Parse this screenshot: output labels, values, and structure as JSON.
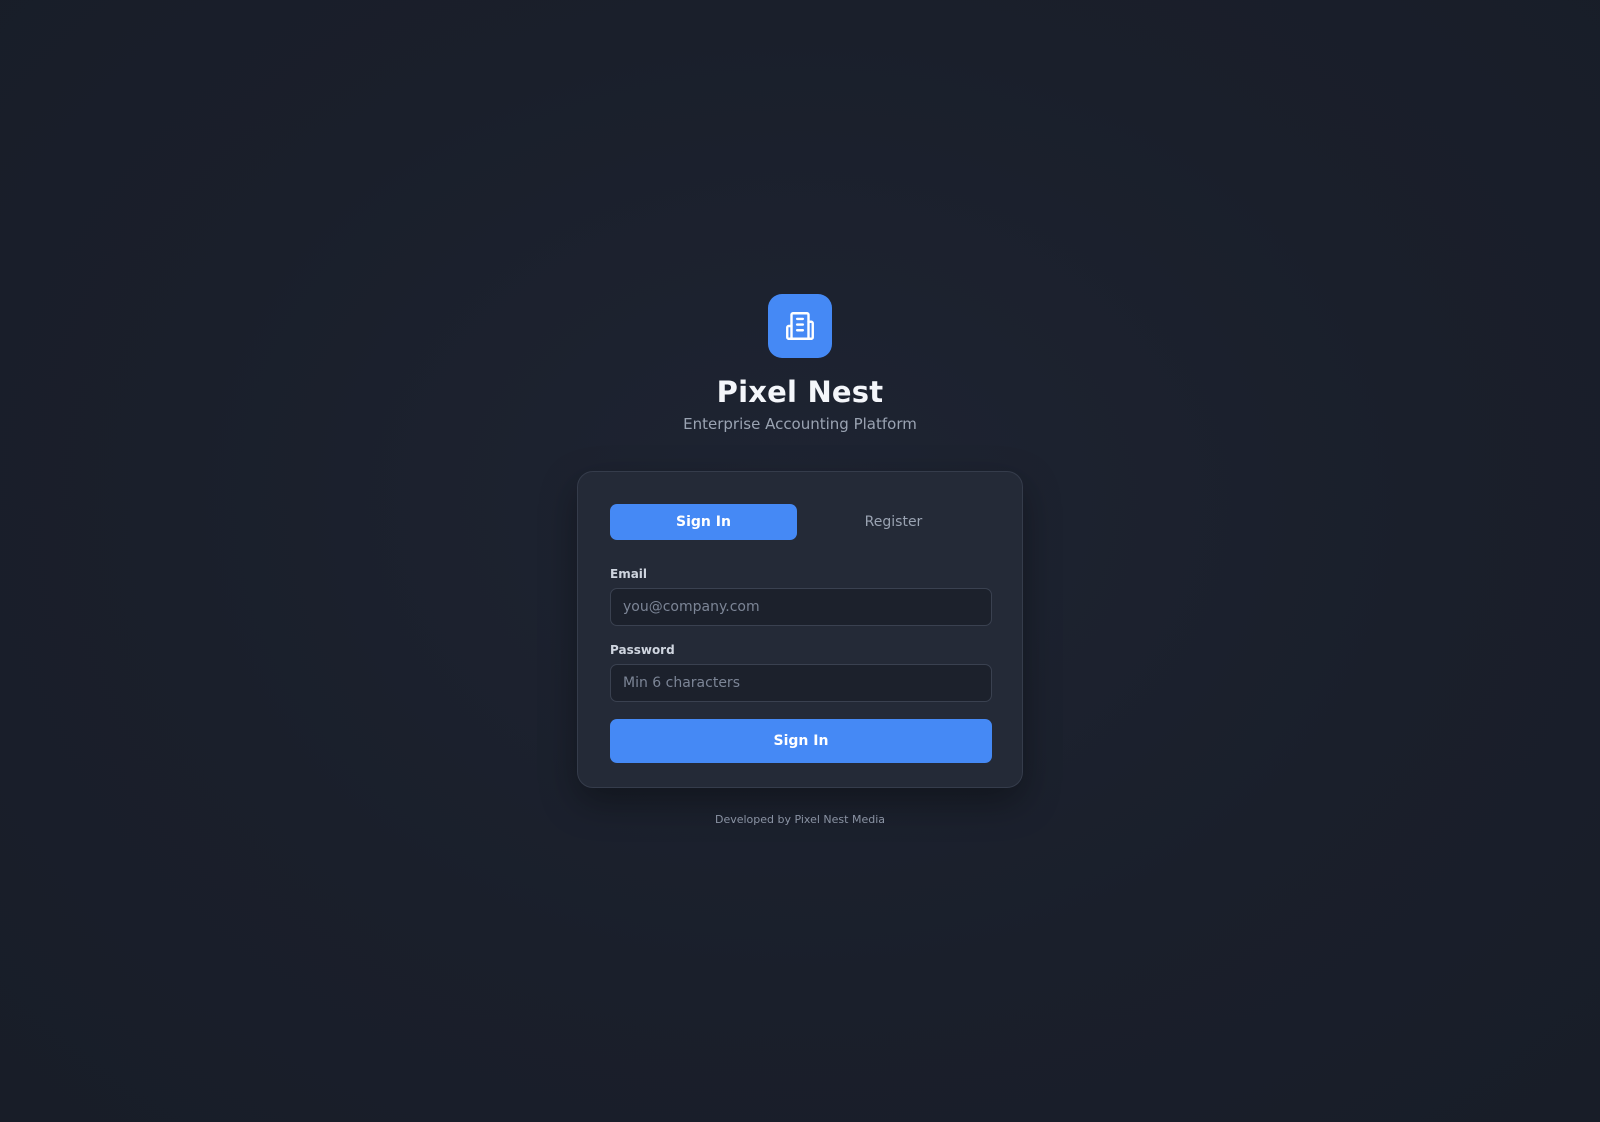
{
  "brand": {
    "icon": "building-icon",
    "title": "Pixel Nest",
    "subtitle": "Enterprise Accounting Platform"
  },
  "auth_tabs": {
    "sign_in_label": "Sign In",
    "register_label": "Register",
    "active": "Sign In"
  },
  "form": {
    "email_label": "Email",
    "email_placeholder": "you@company.com",
    "email_value": "",
    "password_label": "Password",
    "password_placeholder": "Min 6 characters",
    "password_value": "",
    "submit_label": "Sign In"
  },
  "footer": {
    "credit": "Developed by Pixel Nest Media"
  },
  "colors": {
    "accent": "#4589f5",
    "background": "#1a1f2b",
    "card": "#242a37"
  }
}
